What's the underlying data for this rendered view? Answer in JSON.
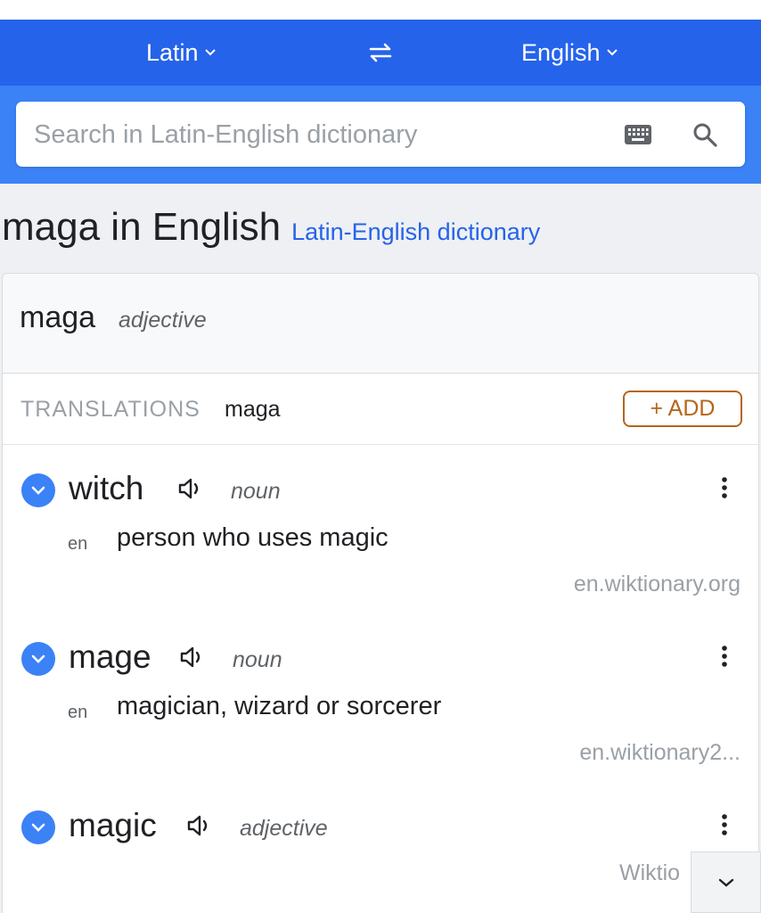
{
  "header": {
    "source_language": "Latin",
    "target_language": "English"
  },
  "search": {
    "placeholder": "Search in Latin-English dictionary"
  },
  "heading": {
    "title": "maga in English",
    "dictionary_link": "Latin-English dictionary"
  },
  "entry_header": {
    "word": "maga",
    "part_of_speech": "adjective"
  },
  "translations_bar": {
    "label": "TRANSLATIONS",
    "word": "maga",
    "add_button": "+ ADD"
  },
  "translations": [
    {
      "word": "witch",
      "part_of_speech": "noun",
      "language_code": "en",
      "definition": "person who uses magic",
      "source": "en.wiktionary.org"
    },
    {
      "word": "mage",
      "part_of_speech": "noun",
      "language_code": "en",
      "definition": "magician, wizard or sorcerer",
      "source": "en.wiktionary2..."
    },
    {
      "word": "magic",
      "part_of_speech": "adjective",
      "source": "Wiktio"
    }
  ],
  "colors": {
    "lang_bar": "#2563eb",
    "search_bar": "#3b82f6",
    "link": "#2563eb",
    "add_button": "#b5651d"
  },
  "icons": {
    "swap": "swap-arrows-icon",
    "keyboard": "keyboard-icon",
    "search": "search-icon",
    "expand": "chevron-down-icon",
    "speaker": "speaker-icon",
    "more": "more-vert-icon",
    "scroll": "chevron-down-icon"
  }
}
